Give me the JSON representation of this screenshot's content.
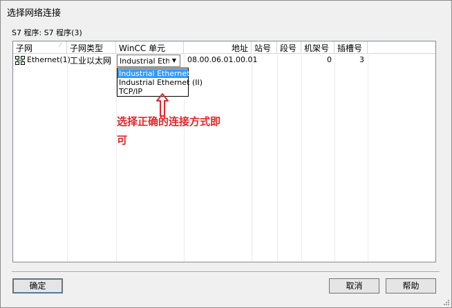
{
  "window": {
    "title": "选择网络连接"
  },
  "program_label": "S7 程序: S7 程序(3)",
  "table": {
    "headers": [
      "子网",
      "子网类型",
      "WinCC 单元",
      "地址",
      "站号",
      "段号",
      "机架号",
      "插槽号"
    ],
    "row": {
      "subnet": "Ethernet(1)",
      "subnet_type": "工业以太网",
      "wincc_unit": "Industrial Ethen",
      "address": "08.00.06.01.00.01",
      "station": "",
      "segment": "",
      "rack": "0",
      "slot": "3"
    }
  },
  "dropdown": {
    "options": [
      "Industrial Ethernet",
      "Industrial Ethernet (II)",
      "TCP/IP"
    ],
    "selected": "Industrial Ethernet"
  },
  "annotation": {
    "line1": "选择正确的连接方式即",
    "line2": "可",
    "color": "#e0262a"
  },
  "buttons": {
    "ok": "确定",
    "cancel": "取消",
    "help": "帮助"
  },
  "icons": {
    "subnet": "network-icon",
    "sort": "sort-indicator-icon",
    "combo": "dropdown-arrow-icon",
    "arrow": "up-arrow-annotation",
    "grip": "resize-grip-icon"
  }
}
